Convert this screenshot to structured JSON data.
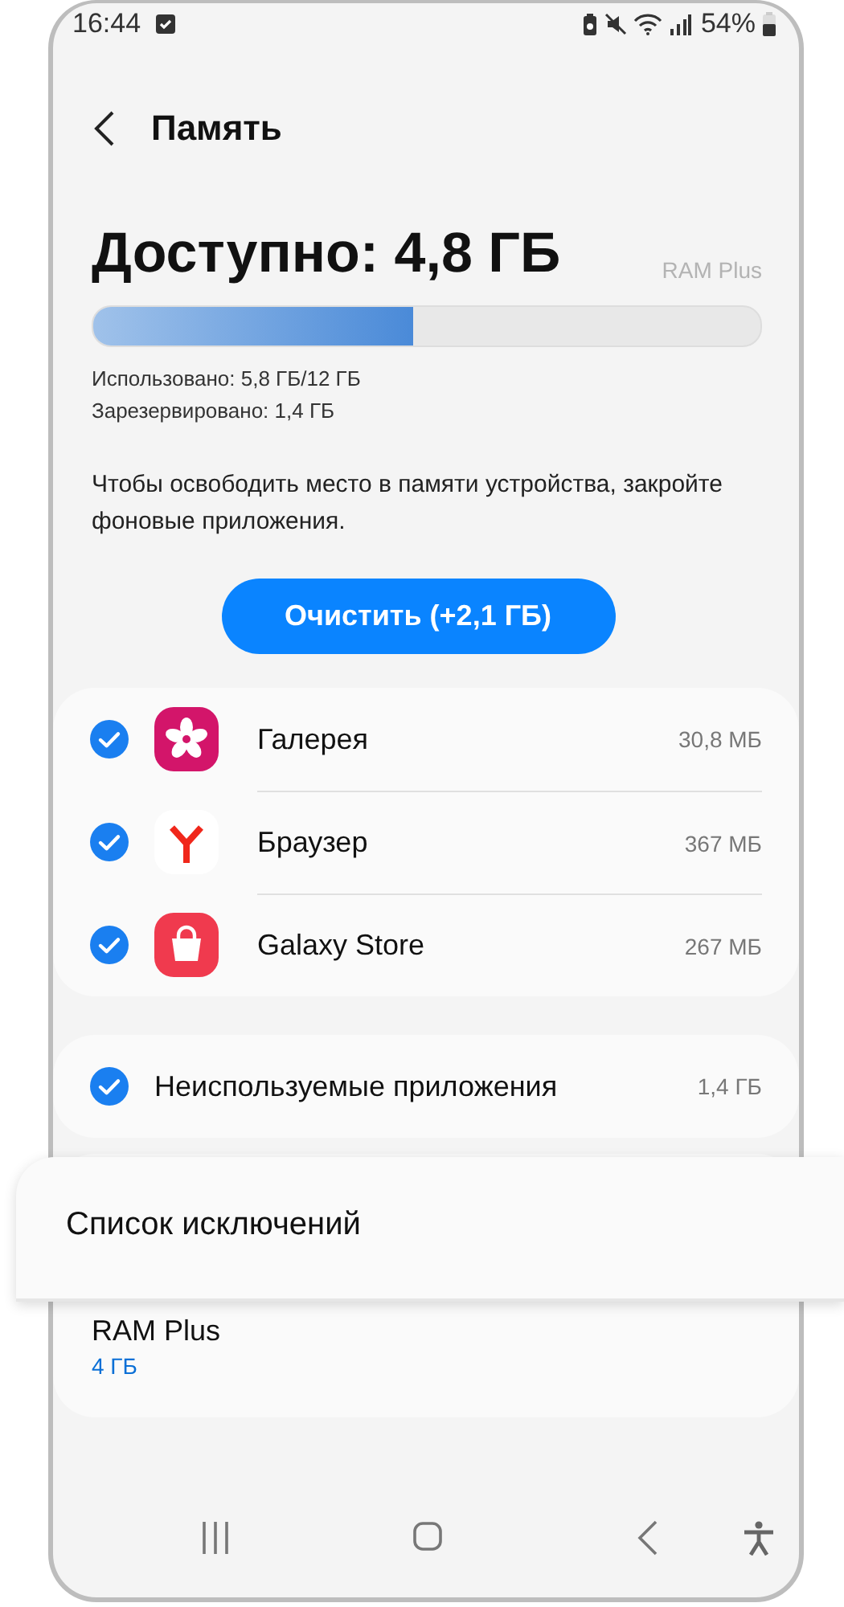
{
  "status_bar": {
    "time": "16:44",
    "battery": "54%"
  },
  "header": {
    "title": "Память"
  },
  "summary": {
    "available": "Доступно: 4,8 ГБ",
    "ram_plus_label": "RAM Plus",
    "level": 0.48,
    "used": "Использовано: 5,8 ГБ/12 ГБ",
    "reserved": "Зарезервировано: 1,4 ГБ"
  },
  "description": "Чтобы освободить место в памяти устройства, закройте фоновые приложения.",
  "clean_button": "Очистить (+2,1 ГБ)",
  "apps": [
    {
      "name": "Галерея",
      "size": "30,8 МБ",
      "checked": true
    },
    {
      "name": "Браузер",
      "size": "367 МБ",
      "checked": true
    },
    {
      "name": "Galaxy Store",
      "size": "267 МБ",
      "checked": true
    }
  ],
  "unused_apps": {
    "name": "Неиспользуемые приложения",
    "size": "1,4 ГБ",
    "checked": true
  },
  "exclusions": {
    "title": "Список исключений"
  },
  "ram_plus": {
    "title": "RAM Plus",
    "value": "4 ГБ"
  }
}
